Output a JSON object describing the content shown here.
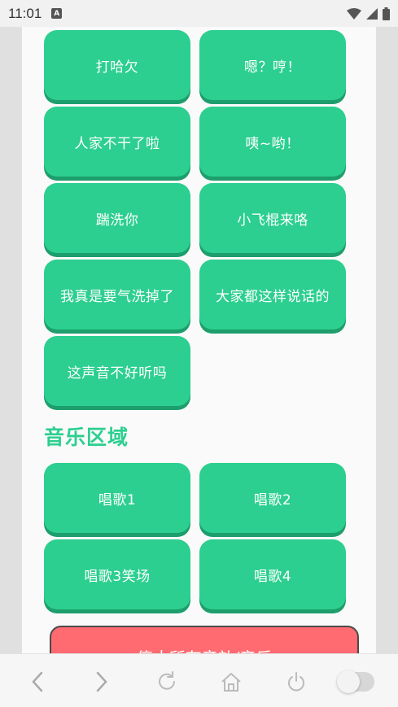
{
  "status_bar": {
    "time": "11:01",
    "app_icon_label": "A",
    "icons": [
      "wifi-icon",
      "cell-signal-icon",
      "battery-icon"
    ]
  },
  "sound_buttons": [
    {
      "label": "打哈欠"
    },
    {
      "label": "嗯？哼！"
    },
    {
      "label": "人家不干了啦"
    },
    {
      "label": "咦~哟！"
    },
    {
      "label": "踹洗你"
    },
    {
      "label": "小飞棍来咯"
    },
    {
      "label": "我真是要气洗掉了"
    },
    {
      "label": "大家都这样说话的"
    },
    {
      "label": "这声音不好听吗"
    }
  ],
  "music_section": {
    "title": "音乐区域",
    "buttons": [
      {
        "label": "唱歌1"
      },
      {
        "label": "唱歌2"
      },
      {
        "label": "唱歌3笑场"
      },
      {
        "label": "唱歌4"
      }
    ]
  },
  "stop_button": {
    "label": "停止所有音效/音乐"
  },
  "colors": {
    "accent": "#2ccf8f",
    "accent_shadow": "#1d9e6c",
    "stop": "#ff6b71"
  },
  "browser_bar": {
    "icons": [
      "back-icon",
      "forward-icon",
      "refresh-icon",
      "home-icon",
      "power-icon",
      "toggle-switch"
    ]
  }
}
